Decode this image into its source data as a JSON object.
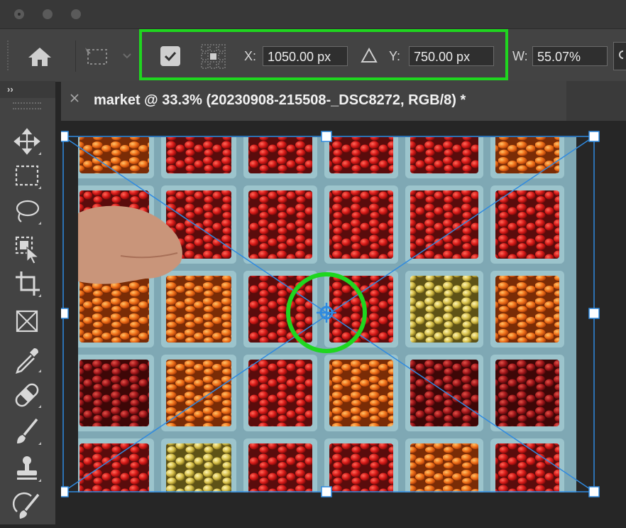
{
  "window": {
    "traffic_lights": [
      "close",
      "minimize",
      "zoom"
    ]
  },
  "options_bar": {
    "home_icon": "home-icon",
    "reference_point_checkbox": true,
    "x_label": "X:",
    "x_value": "1050.00 px",
    "y_label": "Y:",
    "y_value": "750.00 px",
    "w_label": "W:",
    "w_value": "55.07%",
    "delta_icon": "triangle-icon"
  },
  "panel_toggle": "››",
  "document_tab": {
    "title": "market @ 33.3% (20230908-215508-_DSC8272, RGB/8) *"
  },
  "tools": [
    "move-tool",
    "marquee-tool",
    "lasso-tool",
    "object-selection-tool",
    "crop-tool",
    "frame-tool",
    "eyedropper-tool",
    "healing-brush-tool",
    "brush-tool",
    "clone-stamp-tool",
    "history-brush-tool"
  ],
  "colors": {
    "highlight": "#1fd61f",
    "transform": "#2f8ae0",
    "panel": "#434343"
  }
}
